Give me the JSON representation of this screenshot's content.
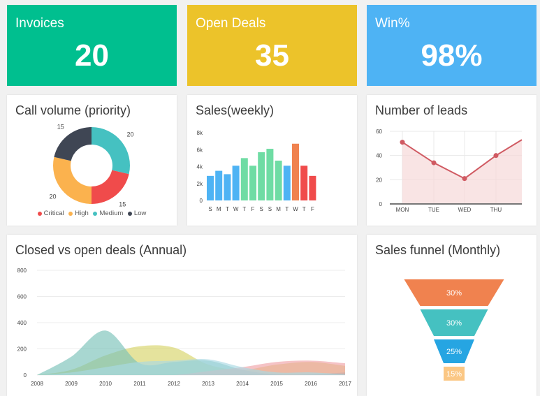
{
  "colors": {
    "green": "#00bf8f",
    "yellow": "#ecc32a",
    "blue": "#4eb3f4",
    "critical": "#f04b4b",
    "high": "#fbb24e",
    "medium": "#45c1c1",
    "low": "#3f4654",
    "salmon": "#f0824f",
    "lead_line": "#d05a62"
  },
  "stats": [
    {
      "label": "Invoices",
      "value": "20"
    },
    {
      "label": "Open Deals",
      "value": "35"
    },
    {
      "label": "Win%",
      "value": "98%"
    }
  ],
  "call_volume": {
    "title": "Call volume (priority)",
    "legend": [
      "Critical",
      "High",
      "Medium",
      "Low"
    ]
  },
  "sales_weekly": {
    "title": "Sales(weekly)"
  },
  "leads": {
    "title": "Number of leads"
  },
  "closed_open": {
    "title": "Closed vs open deals (Annual)"
  },
  "funnel": {
    "title": "Sales funnel (Monthly)"
  },
  "chart_data": [
    {
      "type": "pie",
      "title": "Call volume (priority)",
      "labels": [
        "Critical",
        "High",
        "Medium",
        "Low"
      ],
      "values": [
        15,
        20,
        20,
        15
      ],
      "colors": [
        "#f04b4b",
        "#fbb24e",
        "#45c1c1",
        "#3f4654"
      ],
      "donut": true,
      "legend": "bottom"
    },
    {
      "type": "bar",
      "title": "Sales(weekly)",
      "categories": [
        "S",
        "M",
        "T",
        "W",
        "T",
        "F",
        "S",
        "S",
        "M",
        "T",
        "W",
        "T",
        "F"
      ],
      "values": [
        2900,
        3500,
        3100,
        4100,
        5000,
        4100,
        5700,
        6100,
        4700,
        4100,
        6700,
        4100,
        2900
      ],
      "bar_colors": [
        "#4eb3f4",
        "#4eb3f4",
        "#4eb3f4",
        "#4eb3f4",
        "#6fdca4",
        "#6fdca4",
        "#6fdca4",
        "#6fdca4",
        "#6fdca4",
        "#4eb3f4",
        "#f0824f",
        "#f04b4b",
        "#f04b4b"
      ],
      "yticks": [
        "0",
        "2k",
        "4k",
        "6k",
        "8k"
      ],
      "ylim": [
        0,
        8000
      ],
      "grid": false
    },
    {
      "type": "line",
      "title": "Number of leads",
      "categories": [
        "MON",
        "TUE",
        "WED",
        "THU"
      ],
      "values": [
        51,
        34,
        21,
        40,
        53
      ],
      "yticks": [
        0,
        20,
        40,
        60
      ],
      "ylim": [
        0,
        60
      ],
      "grid": true
    },
    {
      "type": "area",
      "title": "Closed vs open deals (Annual)",
      "x": [
        2008,
        2009,
        2010,
        2011,
        2012,
        2013,
        2014,
        2015,
        2016,
        2017
      ],
      "yticks": [
        0,
        200,
        400,
        600,
        800
      ],
      "ylim": [
        0,
        800
      ],
      "grid": true,
      "series": [
        {
          "values": [
            0,
            40,
            150,
            220,
            210,
            80,
            40,
            80,
            100,
            70
          ],
          "color": "#d7d469"
        },
        {
          "values": [
            0,
            140,
            340,
            90,
            100,
            110,
            40,
            5,
            5,
            20
          ],
          "color": "#79c2b8"
        },
        {
          "values": [
            0,
            0,
            0,
            0,
            0,
            30,
            60,
            100,
            110,
            90
          ],
          "color": "#f0a3a8"
        },
        {
          "values": [
            0,
            20,
            60,
            100,
            110,
            120,
            60,
            20,
            20,
            5
          ],
          "color": "#a9d8e4"
        }
      ]
    },
    {
      "type": "funnel",
      "title": "Sales funnel (Monthly)",
      "labels": [
        "30%",
        "30%",
        "25%",
        "15%"
      ],
      "values": [
        30,
        30,
        25,
        15
      ],
      "colors": [
        "#f0824f",
        "#45c1c1",
        "#26a5e2",
        "#fbc784"
      ]
    }
  ]
}
